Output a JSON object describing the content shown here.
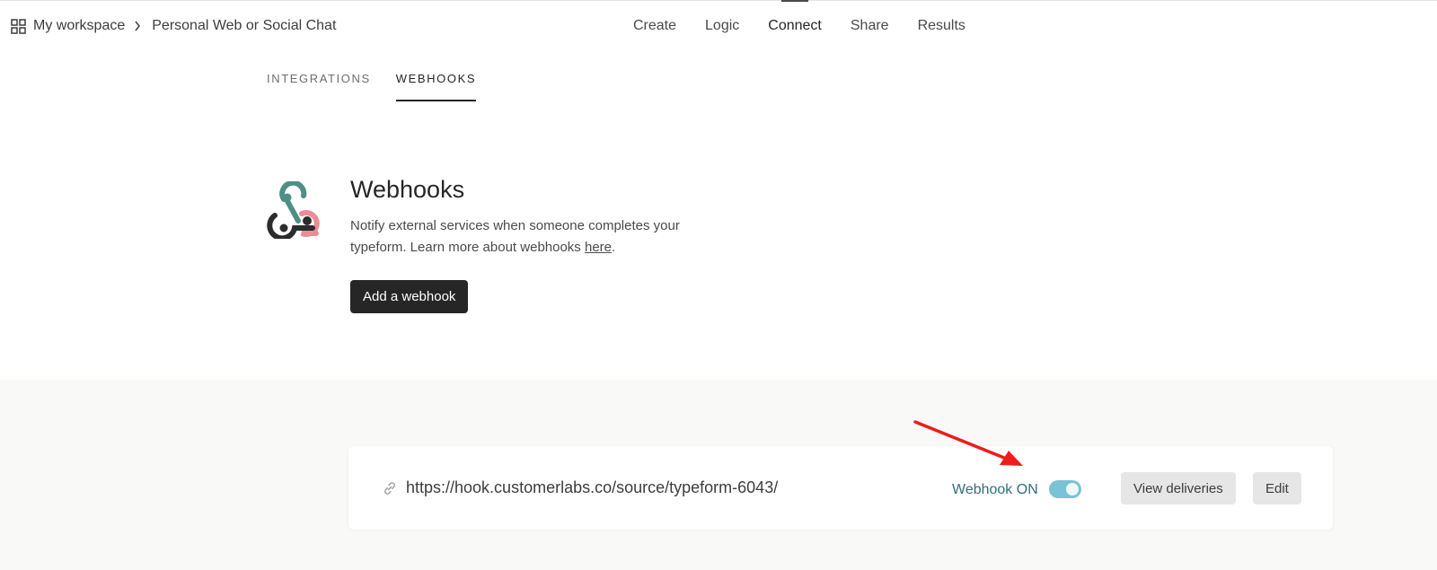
{
  "breadcrumb": {
    "workspace": "My workspace",
    "form_name": "Personal Web or Social Chat"
  },
  "nav": [
    {
      "label": "Create"
    },
    {
      "label": "Logic"
    },
    {
      "label": "Connect"
    },
    {
      "label": "Share"
    },
    {
      "label": "Results"
    }
  ],
  "active_nav": "Connect",
  "subtabs": [
    {
      "label": "INTEGRATIONS"
    },
    {
      "label": "WEBHOOKS"
    }
  ],
  "active_subtab": "WEBHOOKS",
  "hero": {
    "title": "Webhooks",
    "description": "Notify external services when someone completes your typeform. Learn more about webhooks ",
    "link_text": "here",
    "link_suffix": ".",
    "button_label": "Add a webhook"
  },
  "webhook": {
    "url": "https://hook.customerlabs.co/source/typeform-6043/",
    "status_label": "Webhook ON",
    "enabled": true,
    "view_label": "View deliveries",
    "edit_label": "Edit"
  },
  "colors": {
    "toggle_on": "#7ac3d6",
    "status_text": "#2f6f7a",
    "primary_button": "#262627",
    "annotation_arrow": "#ee1c1c",
    "logo_teal": "#4e8f85",
    "logo_pink": "#e98d94",
    "logo_dark": "#2c2c2c"
  },
  "icons": {
    "grid": "workspace-grid-icon",
    "chevron": "chevron-right-icon",
    "logo": "webhook-logo-icon",
    "link": "link-icon"
  }
}
